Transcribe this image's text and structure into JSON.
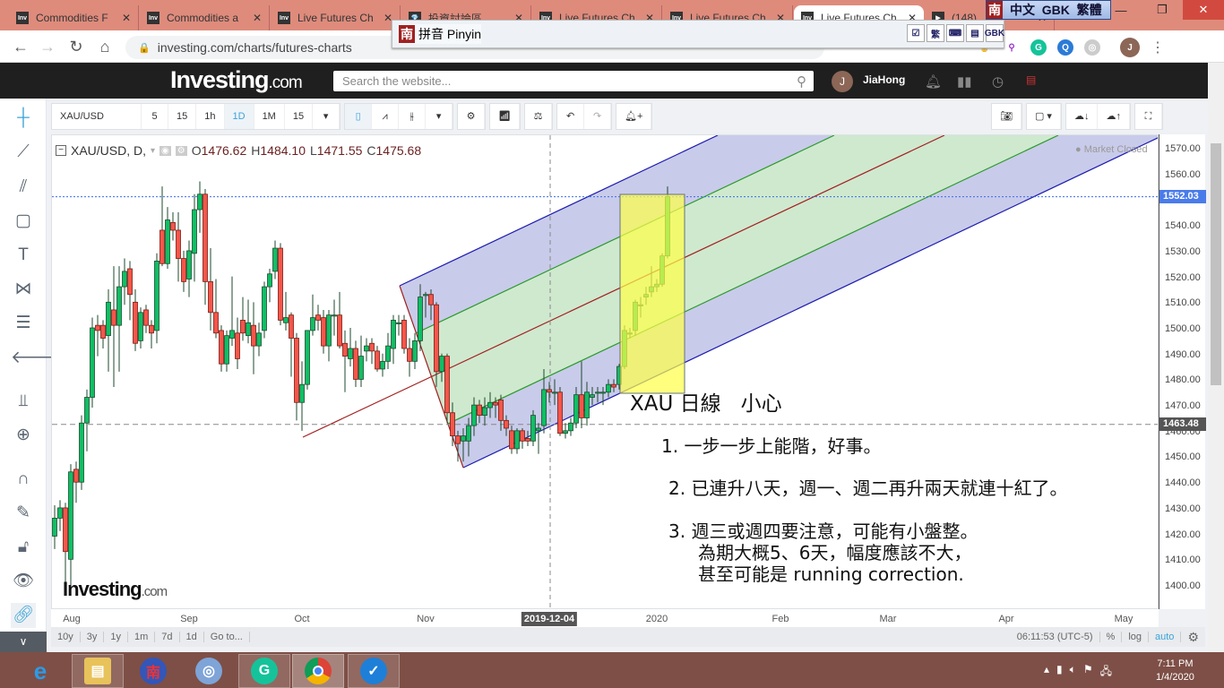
{
  "browser": {
    "tabs": [
      {
        "title": "Commodities F",
        "fav": "Inv"
      },
      {
        "title": "Commodities a",
        "fav": "Inv"
      },
      {
        "title": "Live Futures Ch",
        "fav": "Inv"
      },
      {
        "title": "投資討論區",
        "fav": "💎"
      },
      {
        "title": "Live Futures Ch",
        "fav": "Inv"
      },
      {
        "title": "Live Futures Ch",
        "fav": "Inv"
      },
      {
        "title": "Live Futures Ch",
        "fav": "Inv",
        "active": true
      },
      {
        "title": "(148)",
        "fav": "▶"
      }
    ],
    "url": "investing.com/charts/futures-charts",
    "profile_initial": "J"
  },
  "ime": {
    "label": "拼音 Pinyin",
    "nan": "南",
    "gbk_bar": "中文  GBK  繁體",
    "buttons": [
      "☑",
      "繁",
      "⌨",
      "▤",
      "GBK"
    ]
  },
  "site": {
    "logo": "Investing",
    "logo_suffix": ".com",
    "search_placeholder": "Search the website...",
    "user_initial": "J",
    "user_name": "JiaHong"
  },
  "toolbar": {
    "symbol": "XAU/USD",
    "intervals": [
      "5",
      "15",
      "1h",
      "1D",
      "1M",
      "15"
    ],
    "active_interval": "1D"
  },
  "legend": {
    "title": "XAU/USD, D,",
    "o_label": "O",
    "o": "1476.62",
    "h_label": "H",
    "h": "1484.10",
    "l_label": "L",
    "l": "1471.55",
    "c_label": "C",
    "c": "1475.68",
    "market_status": "Market Closed"
  },
  "price_axis": {
    "ticks": [
      "1570.00",
      "1560.00",
      "1550.00",
      "1540.00",
      "1530.00",
      "1520.00",
      "1510.00",
      "1500.00",
      "1490.00",
      "1480.00",
      "1470.00",
      "1460.00",
      "1450.00",
      "1440.00",
      "1430.00",
      "1420.00",
      "1410.00",
      "1400.00"
    ],
    "last_price": "1552.03",
    "crosshair_price": "1463.48",
    "last_color": "#4a7bea"
  },
  "time_axis": {
    "ticks": [
      "Aug",
      "Sep",
      "Oct",
      "Nov",
      "2019-12-04",
      "2020",
      "Feb",
      "Mar",
      "Apr",
      "May"
    ]
  },
  "annotations": {
    "title": "XAU 日線   小心",
    "n1": "1. 一步一步上能階，好事。",
    "n2": "2. 已連升八天，週一、週二再升兩天就連十紅了。",
    "n3a": "3. 週三或週四要注意，可能有小盤整。",
    "n3b": "為期大概5、6天，幅度應該不大，",
    "n3c": "甚至可能是 running correction."
  },
  "watermark": {
    "text": "Investing",
    "suffix": ".com"
  },
  "bottom_bar": {
    "ranges": [
      "10y",
      "3y",
      "1y",
      "1m",
      "7d",
      "1d",
      "Go to..."
    ],
    "time": "06:11:53 (UTC-5)",
    "pct": "%",
    "log": "log",
    "auto": "auto"
  },
  "taskbar": {
    "time": "7:11 PM",
    "date": "1/4/2020"
  },
  "colors": {
    "up": "#0fbf64",
    "down": "#f4564a",
    "wick": "#1d4a2e"
  },
  "chart_data": {
    "type": "candlestick",
    "symbol": "XAU/USD",
    "interval": "D",
    "ylim": [
      1400,
      1570
    ],
    "x_ticks": [
      "Aug",
      "Sep",
      "Oct",
      "Nov",
      "2019-12-04",
      "2020",
      "Feb",
      "Mar",
      "Apr",
      "May"
    ],
    "ohlc": [
      [
        1420,
        1432,
        1415,
        1427
      ],
      [
        1427,
        1434,
        1422,
        1431
      ],
      [
        1431,
        1433,
        1400,
        1414
      ],
      [
        1411,
        1448,
        1399,
        1445
      ],
      [
        1446,
        1449,
        1433,
        1441
      ],
      [
        1441,
        1467,
        1438,
        1464
      ],
      [
        1464,
        1477,
        1453,
        1474
      ],
      [
        1474,
        1505,
        1470,
        1501
      ],
      [
        1502,
        1506,
        1490,
        1500
      ],
      [
        1502,
        1504,
        1493,
        1497
      ],
      [
        1498,
        1516,
        1484,
        1511
      ],
      [
        1508,
        1525,
        1478,
        1502
      ],
      [
        1502,
        1525,
        1484,
        1517
      ],
      [
        1517,
        1528,
        1510,
        1523
      ],
      [
        1524,
        1527,
        1504,
        1514
      ],
      [
        1511,
        1516,
        1492,
        1495
      ],
      [
        1496,
        1509,
        1493,
        1507
      ],
      [
        1508,
        1510,
        1499,
        1502
      ],
      [
        1502,
        1504,
        1493,
        1499
      ],
      [
        1500,
        1530,
        1495,
        1527
      ],
      [
        1539,
        1556,
        1525,
        1526
      ],
      [
        1526,
        1548,
        1524,
        1543
      ],
      [
        1542,
        1546,
        1535,
        1539
      ],
      [
        1539,
        1546,
        1519,
        1528
      ],
      [
        1528,
        1531,
        1515,
        1519
      ],
      [
        1520,
        1535,
        1513,
        1531
      ],
      [
        1530,
        1553,
        1519,
        1547
      ],
      [
        1547,
        1558,
        1538,
        1553
      ],
      [
        1553,
        1555,
        1510,
        1519
      ],
      [
        1519,
        1532,
        1500,
        1507
      ],
      [
        1507,
        1520,
        1497,
        1499
      ],
      [
        1500,
        1502,
        1484,
        1487
      ],
      [
        1487,
        1500,
        1484,
        1498
      ],
      [
        1497,
        1521,
        1494,
        1500
      ],
      [
        1499,
        1505,
        1485,
        1489
      ],
      [
        1504,
        1513,
        1496,
        1499
      ],
      [
        1498,
        1512,
        1495,
        1503
      ],
      [
        1502,
        1511,
        1483,
        1494
      ],
      [
        1494,
        1503,
        1490,
        1499
      ],
      [
        1500,
        1519,
        1497,
        1517
      ],
      [
        1517,
        1524,
        1511,
        1522
      ],
      [
        1523,
        1535,
        1520,
        1532
      ],
      [
        1532,
        1534,
        1502,
        1504
      ],
      [
        1503,
        1515,
        1500,
        1505
      ],
      [
        1506,
        1507,
        1482,
        1497
      ],
      [
        1497,
        1499,
        1465,
        1472
      ],
      [
        1472,
        1488,
        1461,
        1479
      ],
      [
        1479,
        1500,
        1477,
        1500
      ],
      [
        1500,
        1514,
        1498,
        1505
      ],
      [
        1506,
        1510,
        1500,
        1504
      ],
      [
        1505,
        1508,
        1491,
        1494
      ],
      [
        1494,
        1508,
        1488,
        1506
      ],
      [
        1506,
        1512,
        1498,
        1506
      ],
      [
        1506,
        1515,
        1493,
        1494
      ],
      [
        1495,
        1500,
        1476,
        1490
      ],
      [
        1489,
        1501,
        1486,
        1493
      ],
      [
        1493,
        1496,
        1478,
        1481
      ],
      [
        1481,
        1498,
        1478,
        1490
      ],
      [
        1492,
        1497,
        1488,
        1494
      ],
      [
        1495,
        1497,
        1487,
        1492
      ],
      [
        1492,
        1494,
        1484,
        1485
      ],
      [
        1485,
        1491,
        1482,
        1488
      ],
      [
        1488,
        1499,
        1485,
        1494
      ],
      [
        1493,
        1506,
        1487,
        1504
      ],
      [
        1503,
        1506,
        1498,
        1503
      ],
      [
        1504,
        1506,
        1491,
        1493
      ],
      [
        1493,
        1497,
        1482,
        1488
      ],
      [
        1488,
        1499,
        1485,
        1496
      ],
      [
        1496,
        1518,
        1492,
        1513
      ],
      [
        1514,
        1515,
        1505,
        1514
      ],
      [
        1514,
        1516,
        1504,
        1510
      ],
      [
        1510,
        1511,
        1478,
        1484
      ],
      [
        1484,
        1491,
        1480,
        1490
      ],
      [
        1490,
        1491,
        1464,
        1468
      ],
      [
        1468,
        1472,
        1455,
        1459
      ],
      [
        1459,
        1461,
        1449,
        1456
      ],
      [
        1457,
        1462,
        1449,
        1459
      ],
      [
        1457,
        1466,
        1451,
        1463
      ],
      [
        1463,
        1474,
        1459,
        1471
      ],
      [
        1471,
        1473,
        1464,
        1467
      ],
      [
        1467,
        1474,
        1463,
        1470
      ],
      [
        1470,
        1476,
        1466,
        1472
      ],
      [
        1472,
        1474,
        1466,
        1471
      ],
      [
        1473,
        1475,
        1461,
        1465
      ],
      [
        1465,
        1467,
        1459,
        1462
      ],
      [
        1461,
        1463,
        1452,
        1454
      ],
      [
        1454,
        1462,
        1452,
        1461
      ],
      [
        1461,
        1462,
        1454,
        1457
      ],
      [
        1458,
        1461,
        1455,
        1457
      ],
      [
        1457,
        1469,
        1455,
        1467
      ],
      [
        1461,
        1464,
        1452,
        1462
      ],
      [
        1463,
        1485,
        1460,
        1477
      ],
      [
        1477,
        1480,
        1472,
        1476
      ],
      [
        1476,
        1481,
        1471,
        1476
      ],
      [
        1476,
        1478,
        1459,
        1460
      ],
      [
        1460,
        1464,
        1458,
        1461
      ],
      [
        1461,
        1466,
        1459,
        1464
      ],
      [
        1464,
        1478,
        1462,
        1475
      ],
      [
        1475,
        1488,
        1462,
        1466
      ],
      [
        1466,
        1480,
        1463,
        1476
      ],
      [
        1474,
        1478,
        1471,
        1475
      ],
      [
        1476,
        1478,
        1472,
        1476
      ],
      [
        1476,
        1478,
        1471,
        1476
      ],
      [
        1476,
        1481,
        1474,
        1479
      ],
      [
        1479,
        1481,
        1476,
        1478
      ],
      [
        1479,
        1487,
        1477,
        1486
      ],
      [
        1486,
        1502,
        1485,
        1500
      ],
      [
        1499,
        1501,
        1497,
        1499
      ],
      [
        1500,
        1512,
        1498,
        1511
      ],
      [
        1510,
        1513,
        1505,
        1510
      ],
      [
        1513,
        1517,
        1510,
        1514
      ],
      [
        1515,
        1525,
        1513,
        1517
      ],
      [
        1517,
        1520,
        1515,
        1518
      ],
      [
        1518,
        1530,
        1517,
        1529
      ],
      [
        1529,
        1556,
        1528,
        1552
      ]
    ],
    "last_price": 1552.03,
    "crosshair_price": 1463.48,
    "crosshair_date": "2019-12-04"
  }
}
